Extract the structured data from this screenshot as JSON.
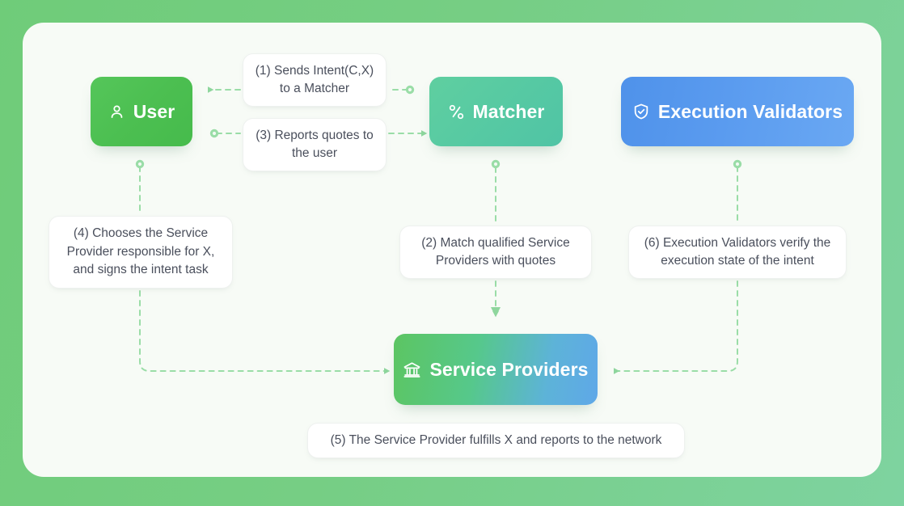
{
  "canvas": {
    "background_outer": "#74ce80",
    "background_card": "#f7fbf6",
    "connector_color": "#93d9a0",
    "caption_text_color": "#4a4f5c"
  },
  "nodes": [
    {
      "id": "user",
      "label": "User",
      "icon": "person-icon",
      "color_start": "#55c65a",
      "color_end": "#46bb4c"
    },
    {
      "id": "matcher",
      "label": "Matcher",
      "icon": "route-icon",
      "color_start": "#5fcfa0",
      "color_end": "#50c4a5"
    },
    {
      "id": "validators",
      "label": "Execution Validators",
      "icon": "shield-check-icon",
      "color_start": "#4f92ea",
      "color_end": "#6aa8f3"
    },
    {
      "id": "providers",
      "label": "Service Providers",
      "icon": "bank-icon",
      "color_start": "#5cc562",
      "color_end": "#5fa8e8"
    }
  ],
  "steps": [
    {
      "id": "step1",
      "number": "(1)",
      "text": "(1) Sends Intent(C,X) to a Matcher",
      "from": "matcher",
      "to": "user"
    },
    {
      "id": "step2",
      "number": "(2)",
      "text": "(2) Match qualified Service Providers with quotes",
      "from": "matcher",
      "to": "providers"
    },
    {
      "id": "step3",
      "number": "(3)",
      "text": "(3) Reports quotes to the user",
      "from": "user",
      "to": "matcher"
    },
    {
      "id": "step4",
      "number": "(4)",
      "text": "(4) Chooses the Service Provider responsible for X, and signs the intent task",
      "from": "user",
      "to": "providers"
    },
    {
      "id": "step5",
      "number": "(5)",
      "text": "(5) The Service Provider fulfills X and reports to the network",
      "from": "providers",
      "to": "network"
    },
    {
      "id": "step6",
      "number": "(6)",
      "text": "(6) Execution Validators verify the execution state of the intent",
      "from": "validators",
      "to": "providers"
    }
  ]
}
